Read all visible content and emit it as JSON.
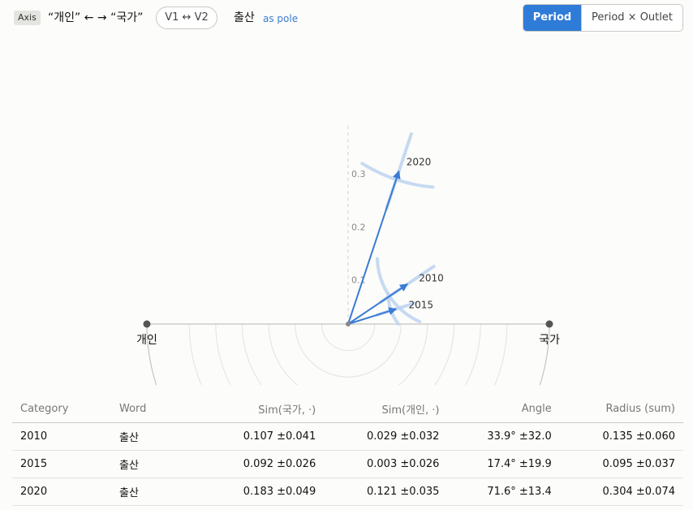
{
  "header": {
    "axis_badge": "Axis",
    "axis_text": "“개인” ← → “국가”",
    "swap_label": "V1 ↔ V2",
    "word": "출산",
    "pole_link": "as pole",
    "modes": [
      "Period",
      "Period × Outlet"
    ],
    "active_mode": "Period"
  },
  "colors": {
    "accent": "#2f7bd8",
    "vector": "#3a7bd5",
    "band": "#bcd4f0"
  },
  "chart_data": {
    "type": "polar-semicircle",
    "left_pole": "개인",
    "right_pole": "국가",
    "radial_ticks": [
      "0.1",
      "0.2",
      "0.3"
    ],
    "radial_tick_values": [
      0.1,
      0.2,
      0.3
    ],
    "r_max": 0.38,
    "vectors": [
      {
        "label": "2010",
        "angle_deg": 33.9,
        "angle_sd": 32.0,
        "radius": 0.135,
        "radius_sd": 0.06
      },
      {
        "label": "2015",
        "angle_deg": 17.4,
        "angle_sd": 19.9,
        "radius": 0.095,
        "radius_sd": 0.037
      },
      {
        "label": "2020",
        "angle_deg": 71.6,
        "angle_sd": 13.4,
        "radius": 0.304,
        "radius_sd": 0.074
      }
    ]
  },
  "table": {
    "headers": [
      "Category",
      "Word",
      "Sim(국가, ·)",
      "Sim(개인, ·)",
      "Angle",
      "Radius (sum)"
    ],
    "rows": [
      [
        "2010",
        "출산",
        "0.107 ±0.041",
        "0.029 ±0.032",
        "33.9° ±32.0",
        "0.135 ±0.060"
      ],
      [
        "2015",
        "출산",
        "0.092 ±0.026",
        "0.003 ±0.026",
        "17.4° ±19.9",
        "0.095 ±0.037"
      ],
      [
        "2020",
        "출산",
        "0.183 ±0.049",
        "0.121 ±0.035",
        "71.6° ±13.4",
        "0.304 ±0.074"
      ]
    ]
  }
}
